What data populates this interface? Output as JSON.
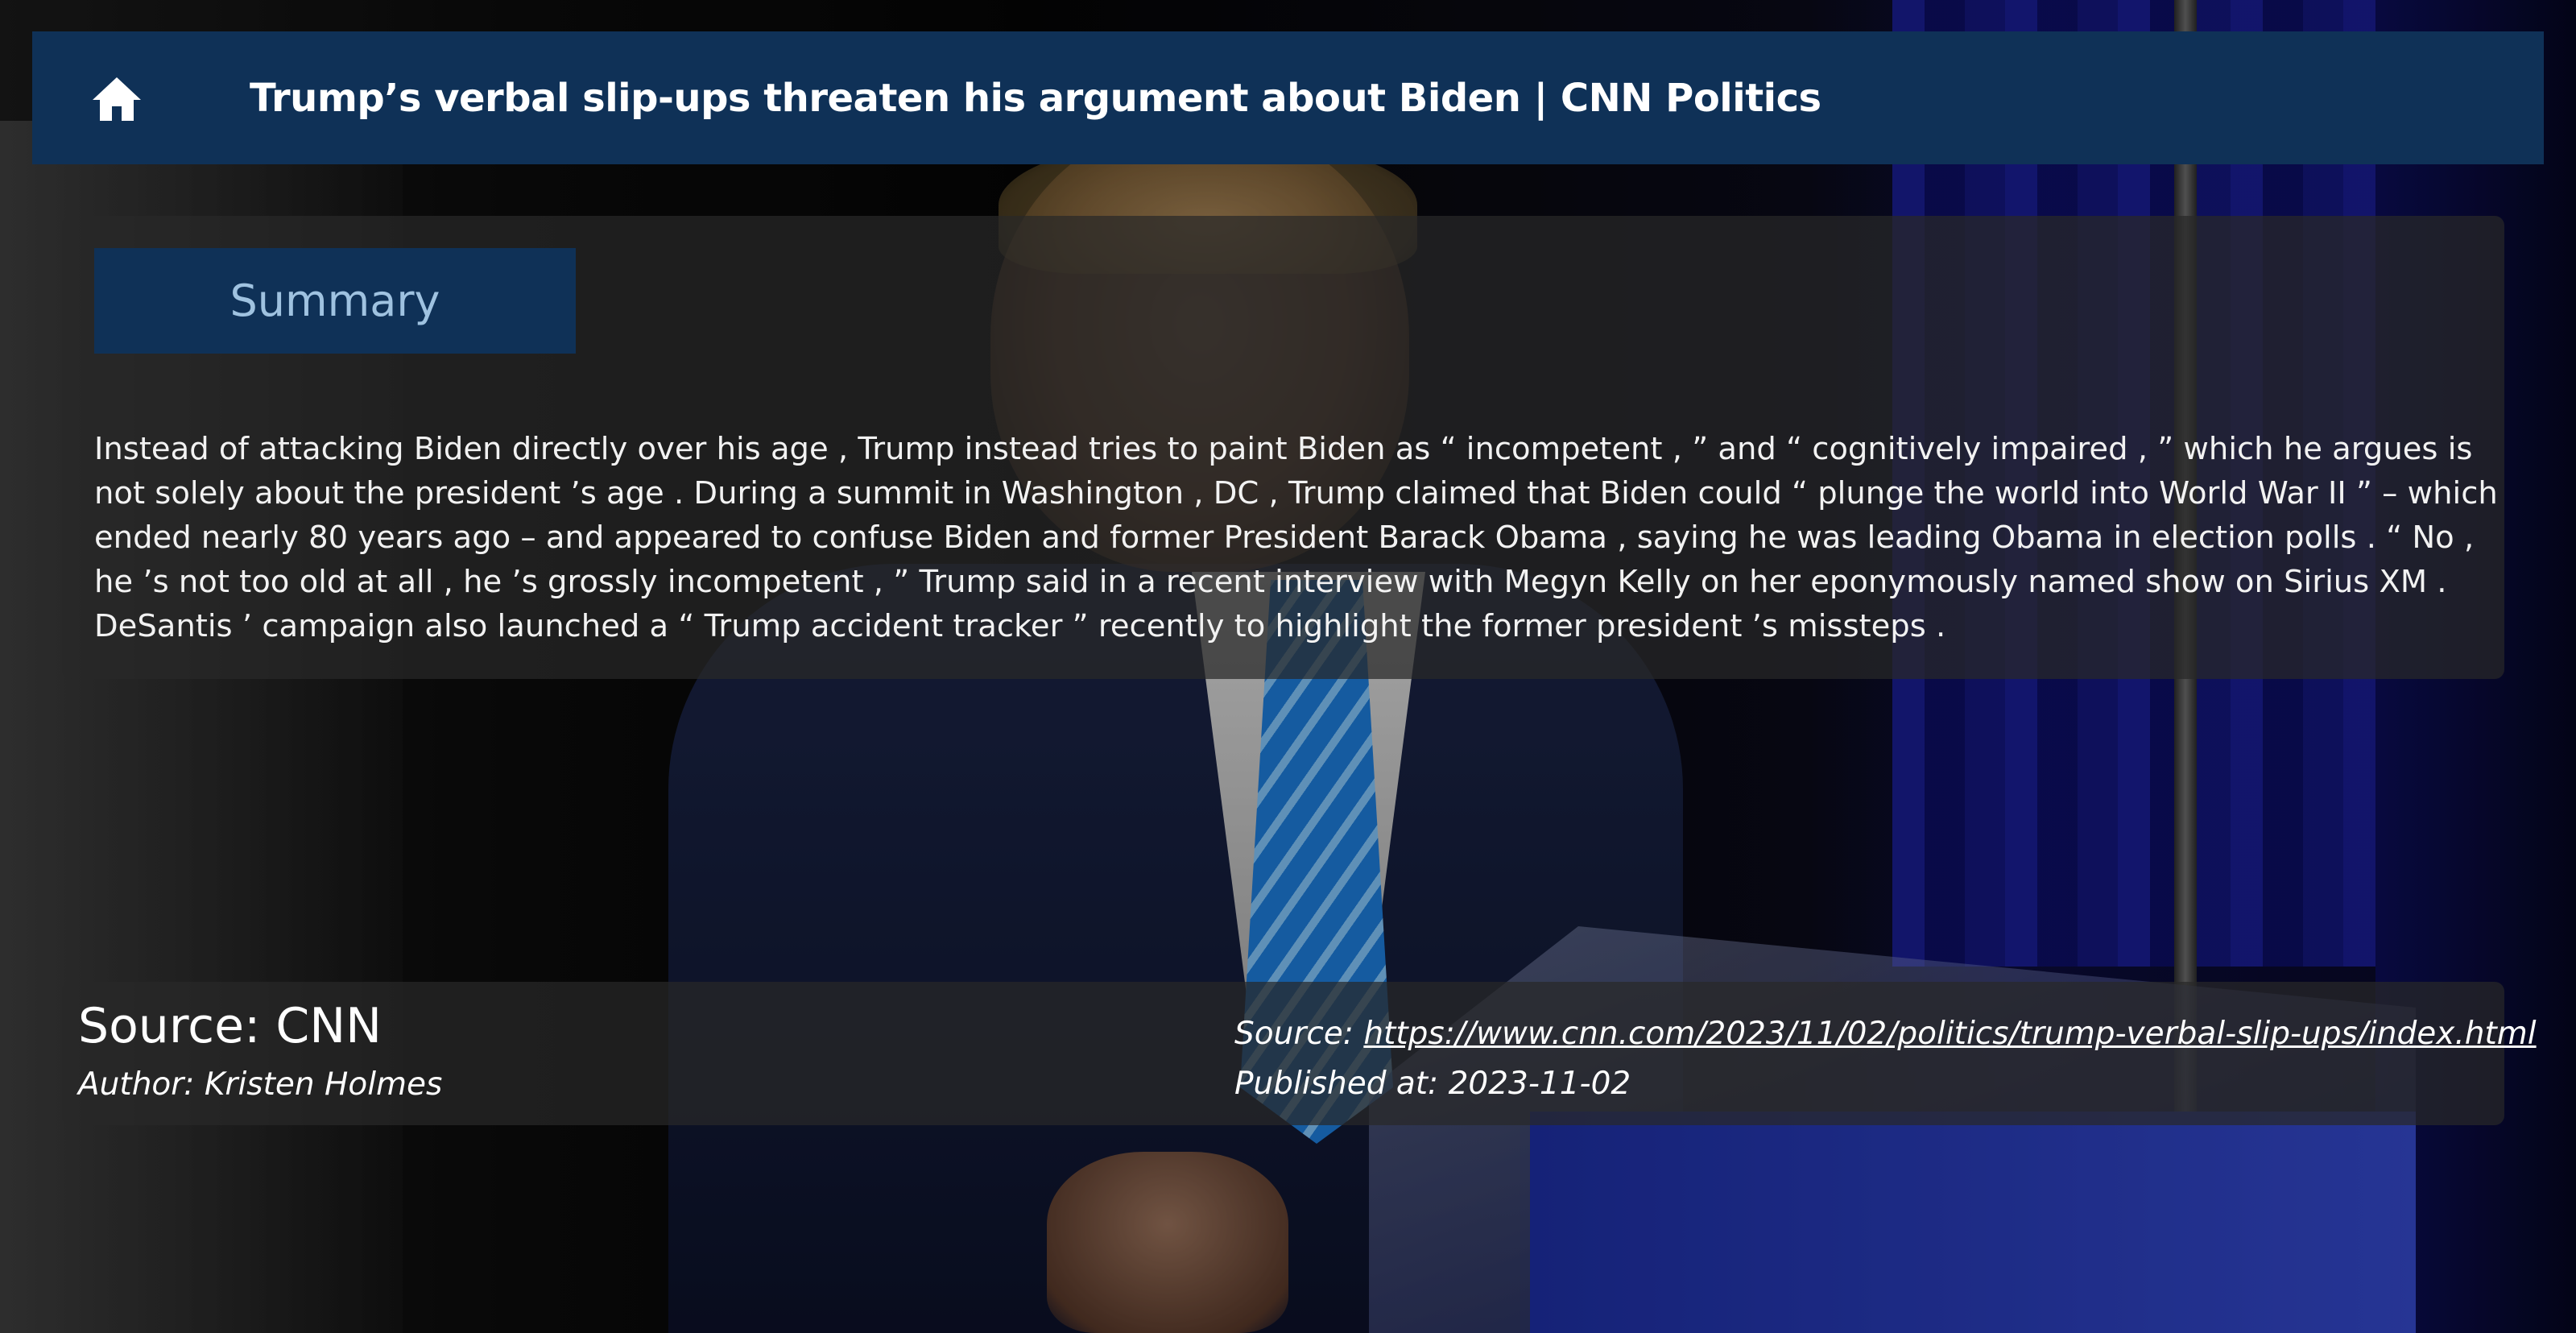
{
  "header": {
    "home_icon": "home-icon",
    "title": "Trump’s verbal slip-ups threaten his argument about Biden | CNN Politics"
  },
  "summary": {
    "heading": "Summary",
    "text": "Instead of attacking Biden directly over his age , Trump instead tries to paint Biden as “ incompetent , ” and “ cognitively impaired , ” which he argues is not solely about the president ’s age . During a summit in Washington , DC , Trump claimed that Biden could “ plunge the world into World War II ” – which ended nearly 80 years ago –   and appeared to confuse Biden and former President Barack Obama , saying he was leading Obama in election polls . “ No , he ’s not too old   at all , he ’s grossly incompetent , ” Trump said in a recent interview with Megyn Kelly on her eponymously named show on Sirius XM . DeSantis ’ campaign also launched a “ Trump accident tracker ” recently   to highlight the former president ’s missteps ."
  },
  "footer": {
    "source_name": "Source: CNN",
    "author": "Author: Kristen Holmes",
    "source_label": "Source: ",
    "source_url": "https://www.cnn.com/2023/11/02/politics/trump-verbal-slip-ups/index.html",
    "published": "Published at: 2023-11-02"
  },
  "colors": {
    "header_bg": "#0f3157",
    "summary_heading": "#9fc2e0",
    "panel_bg": "rgba(40,40,40,0.72)"
  }
}
